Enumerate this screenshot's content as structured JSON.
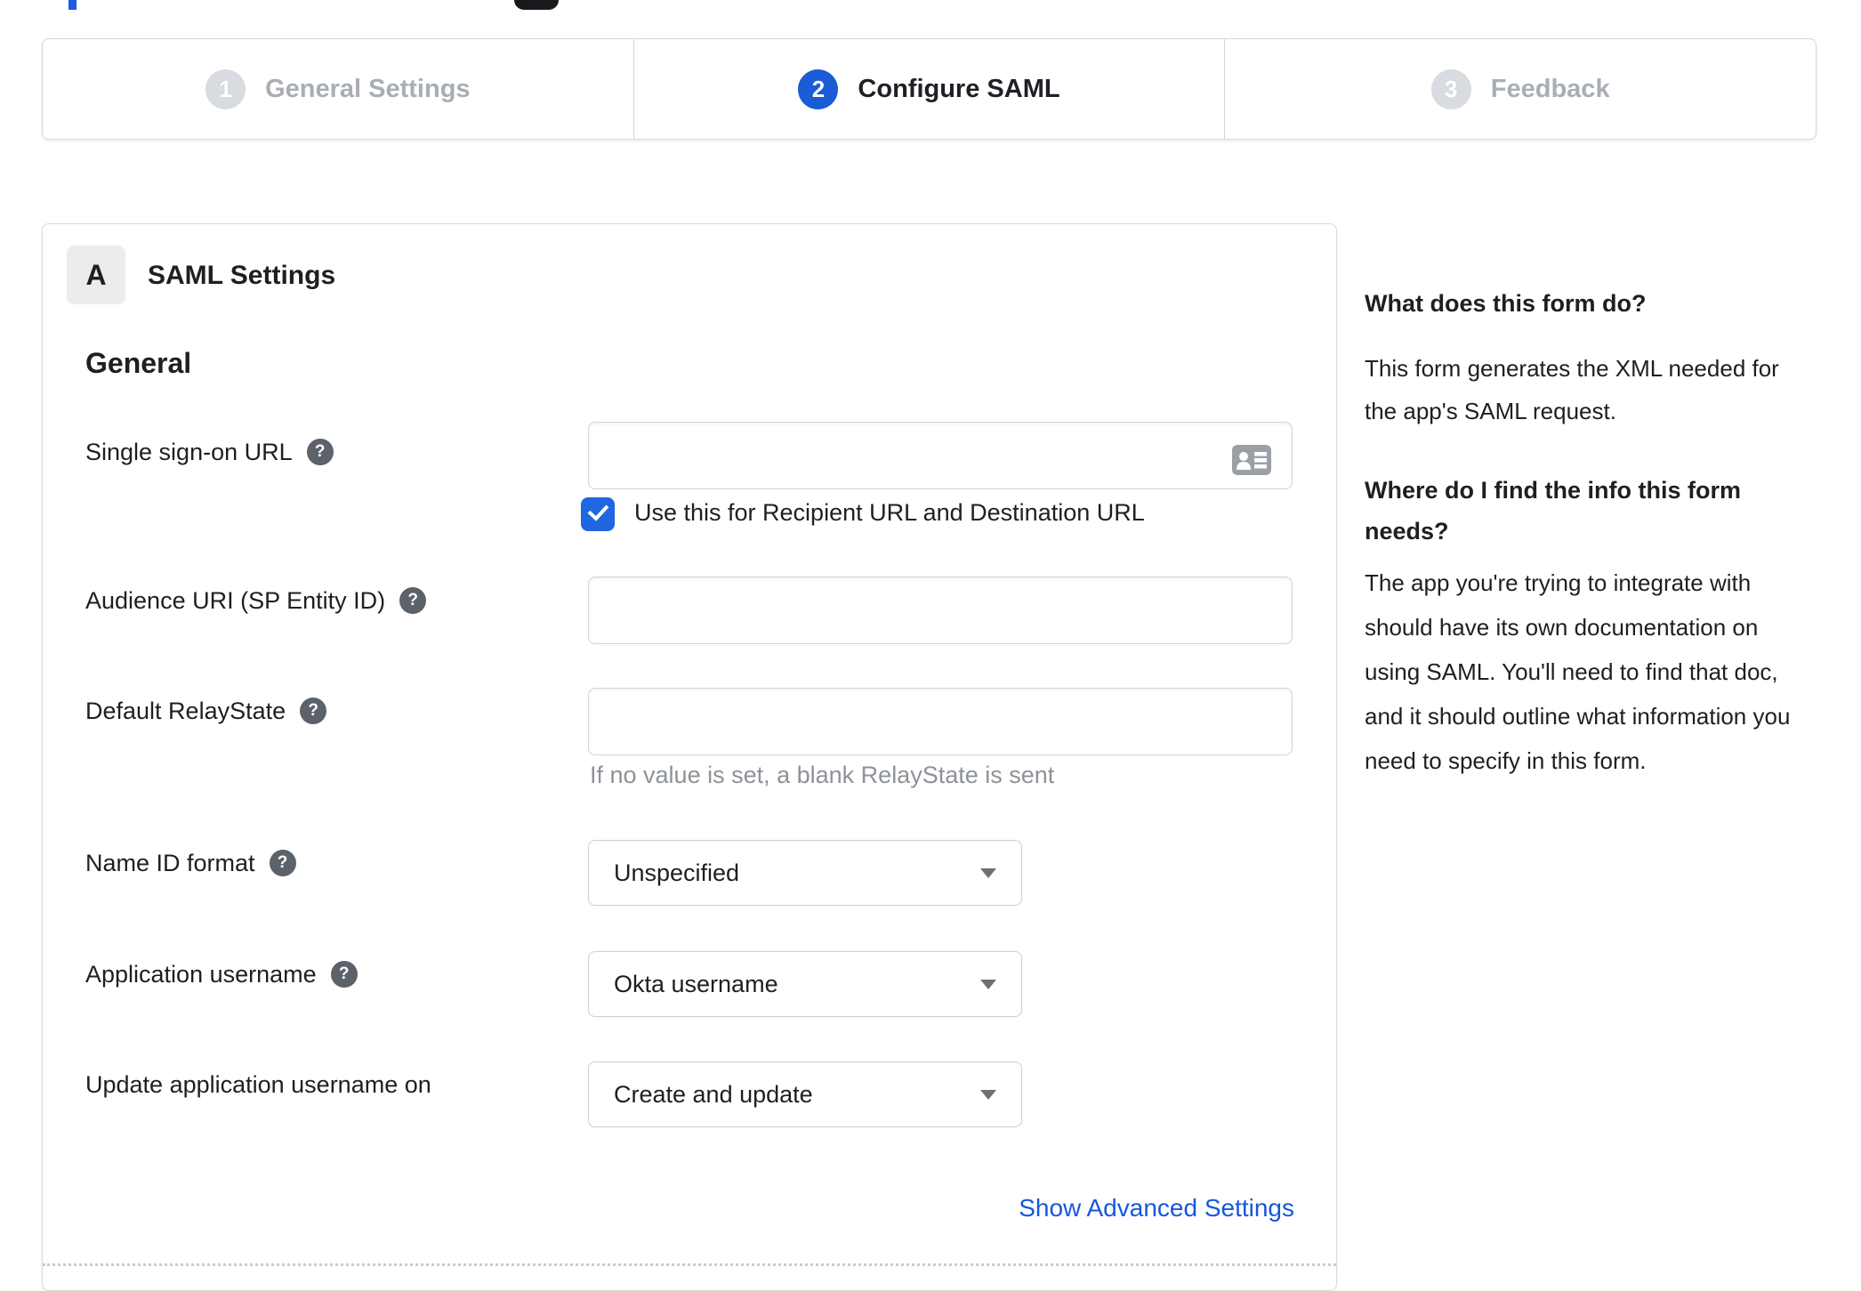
{
  "stepper": {
    "steps": [
      {
        "number": "1",
        "label": "General Settings",
        "active": false
      },
      {
        "number": "2",
        "label": "Configure SAML",
        "active": true
      },
      {
        "number": "3",
        "label": "Feedback",
        "active": false
      }
    ]
  },
  "form": {
    "section_badge": "A",
    "section_title": "SAML Settings",
    "group_title": "General",
    "fields": [
      {
        "label": "Single sign-on URL",
        "value": "",
        "checkbox_label": "Use this for Recipient URL and Destination URL",
        "checkbox_checked": true
      },
      {
        "label": "Audience URI (SP Entity ID)",
        "value": ""
      },
      {
        "label": "Default RelayState",
        "value": "",
        "hint": "If no value is set, a blank RelayState is sent"
      },
      {
        "label": "Name ID format",
        "value": "Unspecified"
      },
      {
        "label": "Application username",
        "value": "Okta username"
      },
      {
        "label": "Update application username on",
        "value": "Create and update"
      }
    ],
    "advanced_link": "Show Advanced Settings"
  },
  "help_panel": {
    "sections": [
      {
        "heading": "What does this form do?",
        "body": "This form generates the XML needed for the app's SAML request."
      },
      {
        "heading": "Where do I find the info this form needs?",
        "body": "The app you're trying to integrate with should have its own documentation on using SAML. You'll need to find that doc, and it should outline what information you need to specify in this form."
      }
    ]
  },
  "icons": {
    "help_char": "?"
  },
  "colors": {
    "accent_blue": "#1a5cd6",
    "link_blue": "#1657dc",
    "inactive_gray": "#a9aeb5",
    "checkbox_blue": "#1f66e0"
  }
}
